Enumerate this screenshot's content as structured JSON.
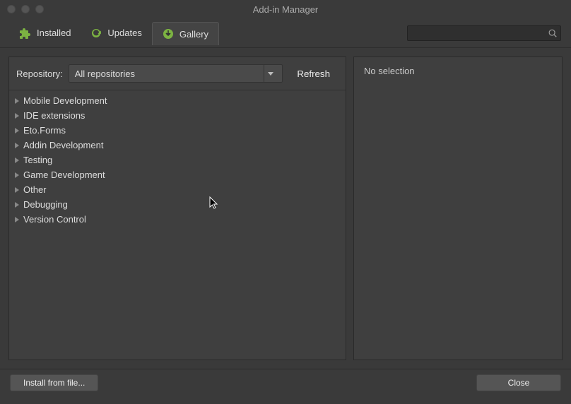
{
  "window": {
    "title": "Add-in Manager"
  },
  "tabs": [
    {
      "label": "Installed",
      "icon": "puzzle"
    },
    {
      "label": "Updates",
      "icon": "update"
    },
    {
      "label": "Gallery",
      "icon": "download"
    }
  ],
  "active_tab": 2,
  "search": {
    "placeholder": ""
  },
  "repo": {
    "label": "Repository:",
    "selected": "All repositories",
    "refresh_label": "Refresh"
  },
  "categories": [
    "Mobile Development",
    "IDE extensions",
    "Eto.Forms",
    "Addin Development",
    "Testing",
    "Game Development",
    "Other",
    "Debugging",
    "Version Control"
  ],
  "detail": {
    "empty_text": "No selection"
  },
  "footer": {
    "install_label": "Install from file...",
    "close_label": "Close"
  },
  "colors": {
    "accent": "#7CB342"
  }
}
